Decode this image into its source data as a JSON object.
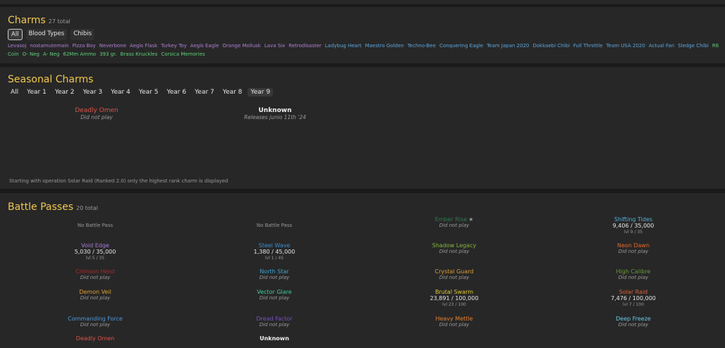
{
  "charms": {
    "title": "Charms",
    "count": "27 total",
    "tabs": [
      "All",
      "Blood Types",
      "Chibis"
    ],
    "items": [
      {
        "text": "Levasoj",
        "color": "#b07fd6"
      },
      {
        "text": "nostamutemain",
        "color": "#b07fd6"
      },
      {
        "text": "Pizza Boy",
        "color": "#b07fd6"
      },
      {
        "text": "Neverbone",
        "color": "#b07fd6"
      },
      {
        "text": "Aegis Flask",
        "color": "#b07fd6"
      },
      {
        "text": "Turkey Toy",
        "color": "#b07fd6"
      },
      {
        "text": "Aegis Eagle",
        "color": "#b07fd6"
      },
      {
        "text": "Orange Mollusk",
        "color": "#b07fd6"
      },
      {
        "text": "Lava Six",
        "color": "#b07fd6"
      },
      {
        "text": "Retrodisaster",
        "color": "#b07fd6"
      },
      {
        "text": "Ladybug Heart",
        "color": "#5ba7e0"
      },
      {
        "text": "Maestro Golden",
        "color": "#5ba7e0"
      },
      {
        "text": "Techno-Bee",
        "color": "#5ba7e0"
      },
      {
        "text": "Conquering Eagle",
        "color": "#5ba7e0"
      },
      {
        "text": "Team Japan 2020",
        "color": "#5ba7e0"
      },
      {
        "text": "Dokkaebi Chibi",
        "color": "#5ba7e0"
      },
      {
        "text": "Full Throttle",
        "color": "#5ba7e0"
      },
      {
        "text": "Team USA 2020",
        "color": "#5ba7e0"
      },
      {
        "text": "Actual Fan",
        "color": "#5ba7e0"
      },
      {
        "text": "Sledge Chibi",
        "color": "#5ba7e0"
      },
      {
        "text": "R6 Coin",
        "color": "#5fd07a"
      },
      {
        "text": "O- Neg",
        "color": "#5fd07a"
      },
      {
        "text": "A- Neg",
        "color": "#5fd07a"
      },
      {
        "text": "62Mm Ammo",
        "color": "#5fd07a"
      },
      {
        "text": "393 gr.",
        "color": "#5fd07a"
      },
      {
        "text": "Brass Knuckles",
        "color": "#5fd07a"
      },
      {
        "text": "Corsica Memories",
        "color": "#5fd07a"
      }
    ]
  },
  "seasonal": {
    "title": "Seasonal Charms",
    "tabs": [
      "All",
      "Year 1",
      "Year 2",
      "Year 3",
      "Year 4",
      "Year 5",
      "Year 6",
      "Year 7",
      "Year 8",
      "Year 9"
    ],
    "cards": [
      {
        "name": "Deadly Omen",
        "status": "Did not play",
        "color": "#e0524a"
      },
      {
        "name": "Unknown",
        "status": "Releases junio 11th '24",
        "color": "#f0f0f0"
      }
    ],
    "note": "Starting with operation Solar Raid (Ranked 2.0) only the highest rank charm is displayed"
  },
  "battle_passes": {
    "title": "Battle Passes",
    "count": "20 total",
    "no_bp": "No Battle Pass",
    "items": [
      {
        "name": "Ember Rise",
        "color": "#2f7a4d",
        "status": "Did not play",
        "star": "★"
      },
      {
        "name": "Shifting Tides",
        "color": "#4fb0d8",
        "points": "9,406 / 35,000",
        "level": "lvl 9 / 35"
      },
      {
        "name": "Void Edge",
        "color": "#a879d8",
        "points": "5,030 / 35,000",
        "level": "lvl 5 / 35"
      },
      {
        "name": "Steel Wave",
        "color": "#3a8cd0",
        "points": "1,380 / 45,000",
        "level": "lvl 1 / 45"
      },
      {
        "name": "Shadow Legacy",
        "color": "#86b83a",
        "status": "Did not play"
      },
      {
        "name": "Neon Dawn",
        "color": "#e06a2a",
        "status": "Did not play"
      },
      {
        "name": "Crimson Heist",
        "color": "#b02a2a",
        "status": "Did not play"
      },
      {
        "name": "North Star",
        "color": "#3aa8d0",
        "status": "Did not play"
      },
      {
        "name": "Crystal Guard",
        "color": "#e0a030",
        "status": "Did not play"
      },
      {
        "name": "High Calibre",
        "color": "#6a9a3a",
        "status": "Did not play"
      },
      {
        "name": "Demon Veil",
        "color": "#e0a030",
        "status": "Did not play"
      },
      {
        "name": "Vector Glare",
        "color": "#3ad0a0",
        "status": "Did not play"
      },
      {
        "name": "Brutal Swarm",
        "color": "#e0c830",
        "points": "23,891 / 100,000",
        "level": "lvl 23 / 100"
      },
      {
        "name": "Solar Raid",
        "color": "#e0602a",
        "points": "7,476 / 100,000",
        "level": "lvl 7 / 100"
      },
      {
        "name": "Commanding Force",
        "color": "#4a9ae0",
        "status": "Did not play"
      },
      {
        "name": "Dread Factor",
        "color": "#7a50c0",
        "status": "Did not play"
      },
      {
        "name": "Heavy Mettle",
        "color": "#e08030",
        "status": "Did not play"
      },
      {
        "name": "Deep Freeze",
        "color": "#6ac8e8",
        "status": "Did not play"
      },
      {
        "name": "Deadly Omen",
        "color": "#e0524a"
      },
      {
        "name": "Unknown",
        "color": "#f0f0f0"
      }
    ]
  }
}
